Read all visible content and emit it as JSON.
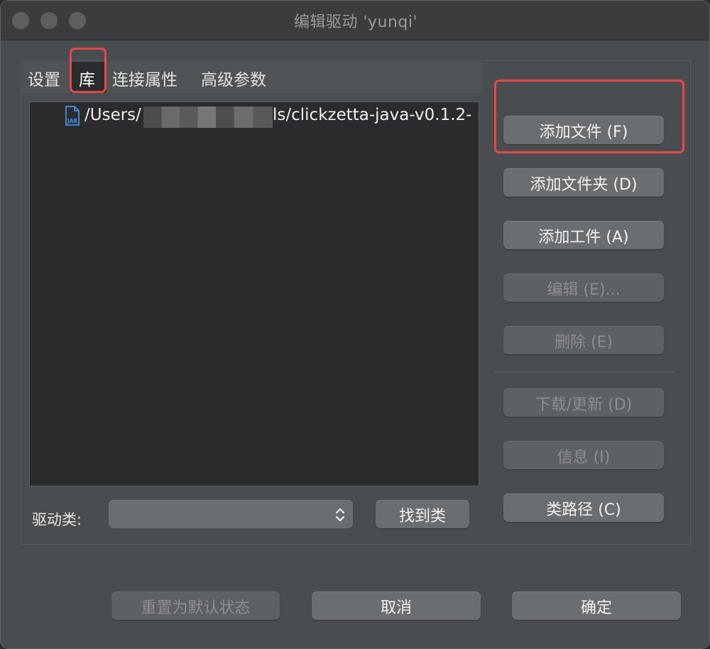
{
  "window": {
    "title": "编辑驱动 'yunqi'"
  },
  "tabs": [
    {
      "label": "设置"
    },
    {
      "label": "库"
    },
    {
      "label": "连接属性"
    },
    {
      "label": "高级参数"
    }
  ],
  "library": {
    "files": [
      {
        "icon": "jar-file-icon",
        "icon_text": "JAR",
        "path_prefix": "/Users/",
        "path_suffix": "ls/clickzetta-java-v0.1.2-"
      }
    ]
  },
  "side_buttons": {
    "add_file": "添加文件 (F)",
    "add_folder": "添加文件夹 (D)",
    "add_artifact": "添加工件 (A)",
    "edit": "编辑 (E)...",
    "delete": "删除 (E)",
    "download_update": "下载/更新 (D)",
    "info": "信息 (I)",
    "classpath": "类路径 (C)"
  },
  "driver_class": {
    "label": "驱动类:",
    "value": "",
    "find_button": "找到类"
  },
  "footer": {
    "reset": "重置为默认状态",
    "cancel": "取消",
    "ok": "确定"
  },
  "colors": {
    "highlight": "#e8474a",
    "window_bg": "#4a4d4f",
    "list_bg": "#2b2b2d",
    "jar_icon": "#4d8fd6"
  }
}
